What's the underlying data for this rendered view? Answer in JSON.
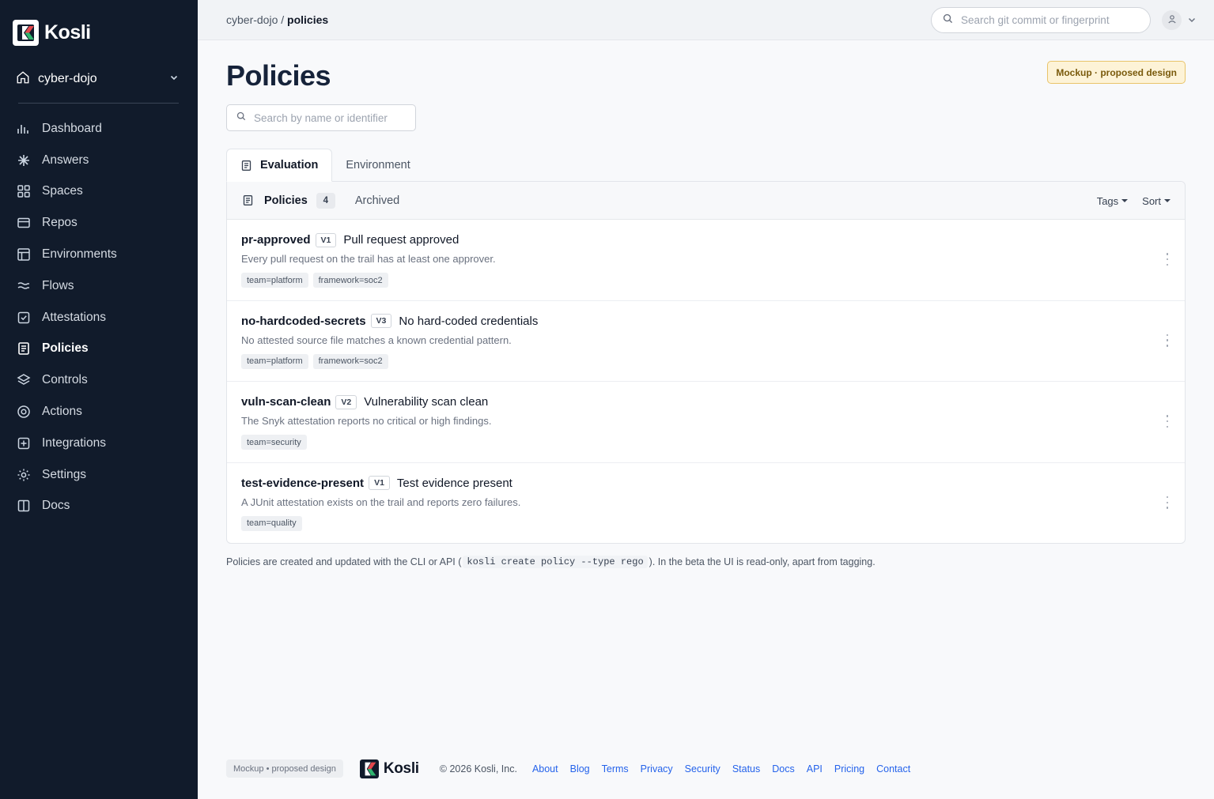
{
  "app": {
    "logo_text": "Kosli"
  },
  "sidebar": {
    "org": {
      "name": "cyber-dojo",
      "icon": "home-icon"
    },
    "items": [
      {
        "label": "Dashboard",
        "icon": "bar-chart-icon",
        "active": false
      },
      {
        "label": "Answers",
        "icon": "sparkle-icon",
        "active": false
      },
      {
        "label": "Spaces",
        "icon": "grid-icon",
        "active": false
      },
      {
        "label": "Repos",
        "icon": "repo-icon",
        "active": false
      },
      {
        "label": "Environments",
        "icon": "layout-icon",
        "active": false
      },
      {
        "label": "Flows",
        "icon": "waves-icon",
        "active": false
      },
      {
        "label": "Attestations",
        "icon": "check-square-icon",
        "active": false
      },
      {
        "label": "Policies",
        "icon": "document-icon",
        "active": true
      },
      {
        "label": "Controls",
        "icon": "layers-icon",
        "active": false
      },
      {
        "label": "Actions",
        "icon": "target-icon",
        "active": false
      },
      {
        "label": "Integrations",
        "icon": "plus-square-icon",
        "active": false
      },
      {
        "label": "Settings",
        "icon": "gear-icon",
        "active": false
      },
      {
        "label": "Docs",
        "icon": "book-icon",
        "active": false
      }
    ]
  },
  "topbar": {
    "breadcrumb": {
      "org": "cyber-dojo",
      "separator": " / ",
      "current": "policies"
    },
    "search_placeholder": "Search git commit or fingerprint"
  },
  "page": {
    "title": "Policies",
    "mock_badge": "Mockup · proposed design",
    "search_placeholder": "Search by name or identifier",
    "tabs": [
      {
        "label": "Evaluation",
        "active": true
      },
      {
        "label": "Environment",
        "active": false
      }
    ],
    "panel": {
      "policies_label": "Policies",
      "count": "4",
      "archived_label": "Archived",
      "tags_label": "Tags",
      "sort_label": "Sort"
    },
    "policies": [
      {
        "id": "pr-approved",
        "version": "V1",
        "name": "Pull request approved",
        "description": "Every pull request on the trail has at least one approver.",
        "tags": [
          "team=platform",
          "framework=soc2"
        ]
      },
      {
        "id": "no-hardcoded-secrets",
        "version": "V3",
        "name": "No hard-coded credentials",
        "description": "No attested source file matches a known credential pattern.",
        "tags": [
          "team=platform",
          "framework=soc2"
        ]
      },
      {
        "id": "vuln-scan-clean",
        "version": "V2",
        "name": "Vulnerability scan clean",
        "description": "The Snyk attestation reports no critical or high findings.",
        "tags": [
          "team=security"
        ]
      },
      {
        "id": "test-evidence-present",
        "version": "V1",
        "name": "Test evidence present",
        "description": "A JUnit attestation exists on the trail and reports zero failures.",
        "tags": [
          "team=quality"
        ]
      }
    ],
    "note": {
      "before": "Policies are created and updated with the CLI or API (",
      "code": "kosli create policy --type rego",
      "after": "). In the beta the UI is read-only, apart from tagging."
    }
  },
  "footer": {
    "badge": "Mockup • proposed design",
    "logo_text": "Kosli",
    "copyright": "© 2026 Kosli, Inc.",
    "links": [
      "About",
      "Blog",
      "Terms",
      "Privacy",
      "Security",
      "Status",
      "Docs",
      "API",
      "Pricing",
      "Contact"
    ]
  },
  "colors": {
    "sidebar_bg": "#111b2b",
    "link": "#2563eb",
    "badge_bg": "#fdf3d7",
    "brand_red": "#e5484d",
    "brand_green": "#2fb66f"
  }
}
